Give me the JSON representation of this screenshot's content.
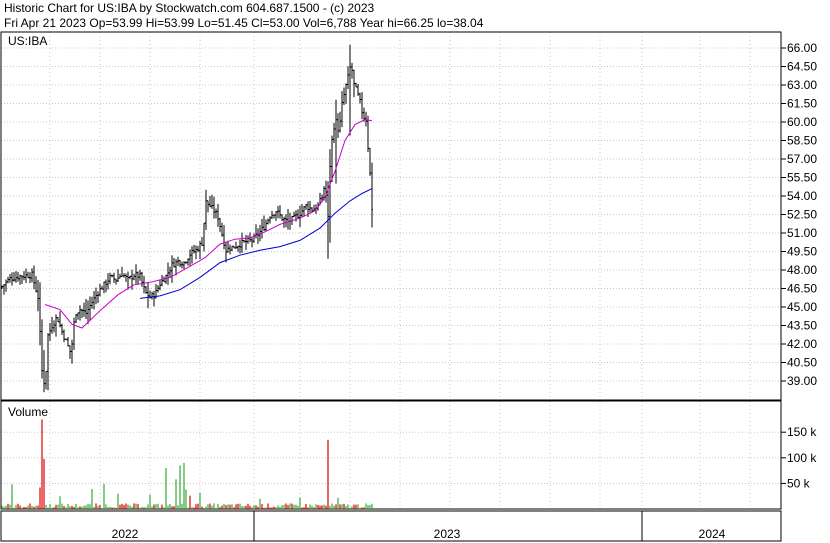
{
  "header": {
    "line1": "Historic Chart for US:IBA by Stockwatch.com 604.687.1500 - (c) 2023",
    "line2": "Fri Apr 21 2023   Op=53.99   Hi=53.99   Lo=51.45   Cl=53.00   Vol=6,788   Year hi=66.25   lo=38.04"
  },
  "chart_data": {
    "type": "candlestick",
    "symbol_label": "US:IBA",
    "volume_label": "Volume",
    "price_axis": {
      "min": 38.04,
      "max": 66.25,
      "ticks": [
        "66.00",
        "64.50",
        "63.00",
        "61.50",
        "60.00",
        "58.50",
        "57.00",
        "55.50",
        "54.00",
        "52.50",
        "51.00",
        "49.50",
        "48.00",
        "46.50",
        "45.00",
        "43.50",
        "42.00",
        "40.50",
        "39.00"
      ]
    },
    "volume_axis": {
      "ticks": [
        "150 k",
        "100 k",
        "50 k"
      ],
      "tick_values": [
        150000,
        100000,
        50000
      ]
    },
    "time_axis": {
      "labels": [
        "2022",
        "2023",
        "2024"
      ]
    },
    "colors": {
      "price": "#000000",
      "ma_short": "#cc00cc",
      "ma_long": "#0000cc",
      "vol_up": "#33aa33",
      "vol_down": "#dd0000",
      "grid": "#c8c8c8"
    },
    "price_keypoints": [
      [
        0,
        46.5
      ],
      [
        10,
        47.3
      ],
      [
        20,
        47.5
      ],
      [
        32,
        47.6
      ],
      [
        38,
        45.8
      ],
      [
        42,
        39.8
      ],
      [
        45,
        38.5
      ],
      [
        48,
        42.7
      ],
      [
        52,
        43.5
      ],
      [
        57,
        44.2
      ],
      [
        62,
        43.0
      ],
      [
        67,
        42.0
      ],
      [
        71,
        41.2
      ],
      [
        75,
        44.5
      ],
      [
        80,
        44.8
      ],
      [
        86,
        44.5
      ],
      [
        92,
        45.4
      ],
      [
        98,
        46.2
      ],
      [
        104,
        46.8
      ],
      [
        110,
        47.4
      ],
      [
        116,
        47.2
      ],
      [
        122,
        47.7
      ],
      [
        128,
        47.2
      ],
      [
        134,
        47.6
      ],
      [
        140,
        47.5
      ],
      [
        145,
        46.2
      ],
      [
        150,
        45.8
      ],
      [
        155,
        46.0
      ],
      [
        160,
        46.9
      ],
      [
        166,
        47.5
      ],
      [
        172,
        48.4
      ],
      [
        178,
        48.7
      ],
      [
        184,
        48.6
      ],
      [
        190,
        49.3
      ],
      [
        196,
        49.6
      ],
      [
        202,
        50.2
      ],
      [
        206,
        53.5
      ],
      [
        210,
        53.2
      ],
      [
        214,
        52.8
      ],
      [
        218,
        52.3
      ],
      [
        222,
        50.9
      ],
      [
        226,
        49.6
      ],
      [
        230,
        49.8
      ],
      [
        234,
        49.9
      ],
      [
        240,
        50.1
      ],
      [
        246,
        50.3
      ],
      [
        252,
        50.4
      ],
      [
        258,
        50.9
      ],
      [
        264,
        51.5
      ],
      [
        270,
        52.4
      ],
      [
        276,
        52.8
      ],
      [
        282,
        52.2
      ],
      [
        288,
        51.9
      ],
      [
        294,
        52.2
      ],
      [
        300,
        52.6
      ],
      [
        306,
        53.2
      ],
      [
        312,
        52.9
      ],
      [
        318,
        53.2
      ],
      [
        322,
        53.9
      ],
      [
        325,
        55.0
      ],
      [
        328,
        52.2
      ],
      [
        330,
        56.5
      ],
      [
        333,
        59.5
      ],
      [
        336,
        60.0
      ],
      [
        339,
        59.2
      ],
      [
        342,
        61.4
      ],
      [
        345,
        62.6
      ],
      [
        348,
        63.6
      ],
      [
        351,
        64.8
      ],
      [
        354,
        63.0
      ],
      [
        357,
        62.4
      ],
      [
        360,
        61.6
      ],
      [
        363,
        60.5
      ],
      [
        366,
        60.2
      ],
      [
        368,
        58.0
      ],
      [
        370,
        55.8
      ],
      [
        372,
        53.0
      ]
    ],
    "ma_short_keypoints": [
      [
        45,
        45.2
      ],
      [
        60,
        44.8
      ],
      [
        72,
        43.6
      ],
      [
        82,
        43.3
      ],
      [
        100,
        44.7
      ],
      [
        118,
        46.0
      ],
      [
        134,
        46.8
      ],
      [
        150,
        47.0
      ],
      [
        170,
        47.4
      ],
      [
        190,
        48.3
      ],
      [
        205,
        49.0
      ],
      [
        220,
        50.1
      ],
      [
        235,
        50.5
      ],
      [
        250,
        50.6
      ],
      [
        265,
        51.1
      ],
      [
        280,
        51.7
      ],
      [
        300,
        52.2
      ],
      [
        315,
        52.8
      ],
      [
        325,
        53.9
      ],
      [
        335,
        56.0
      ],
      [
        345,
        58.5
      ],
      [
        355,
        59.8
      ],
      [
        365,
        60.2
      ],
      [
        372,
        60.1
      ]
    ],
    "ma_long_keypoints": [
      [
        140,
        45.7
      ],
      [
        160,
        45.9
      ],
      [
        180,
        46.4
      ],
      [
        200,
        47.4
      ],
      [
        220,
        48.6
      ],
      [
        240,
        49.2
      ],
      [
        260,
        49.6
      ],
      [
        280,
        49.9
      ],
      [
        300,
        50.4
      ],
      [
        320,
        51.4
      ],
      [
        335,
        52.6
      ],
      [
        350,
        53.6
      ],
      [
        362,
        54.2
      ],
      [
        372,
        54.6
      ]
    ],
    "volume_spikes": [
      [
        43,
        175000,
        "down"
      ],
      [
        40,
        42000,
        "down"
      ],
      [
        44,
        98000,
        "down"
      ],
      [
        93,
        39000,
        "up"
      ],
      [
        105,
        49000,
        "up"
      ],
      [
        166,
        80000,
        "up"
      ],
      [
        177,
        58000,
        "up"
      ],
      [
        180,
        85000,
        "up"
      ],
      [
        184,
        90000,
        "up"
      ],
      [
        187,
        38000,
        "up"
      ],
      [
        190,
        26000,
        "down"
      ],
      [
        329,
        135000,
        "down"
      ],
      [
        339,
        22000,
        "up"
      ],
      [
        12,
        48000,
        "up"
      ],
      [
        60,
        25000,
        "up"
      ],
      [
        118,
        30000,
        "up"
      ],
      [
        150,
        28000,
        "up"
      ],
      [
        200,
        32000,
        "up"
      ],
      [
        260,
        20000,
        "up"
      ],
      [
        300,
        22000,
        "up"
      ]
    ]
  }
}
